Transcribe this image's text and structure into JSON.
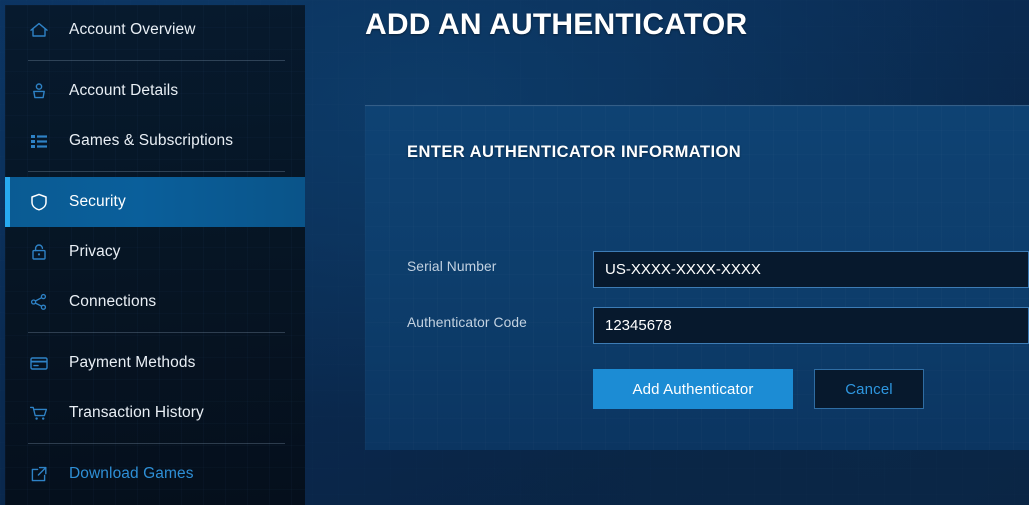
{
  "page": {
    "title": "ADD AN AUTHENTICATOR"
  },
  "sidebar": {
    "items": [
      {
        "id": "account-overview",
        "label": "Account Overview",
        "icon": "home-icon",
        "state": "default"
      },
      {
        "id": "account-details",
        "label": "Account Details",
        "icon": "person-icon",
        "state": "default"
      },
      {
        "id": "games-subscriptions",
        "label": "Games & Subscriptions",
        "icon": "list-icon",
        "state": "default"
      },
      {
        "id": "security",
        "label": "Security",
        "icon": "shield-icon",
        "state": "active"
      },
      {
        "id": "privacy",
        "label": "Privacy",
        "icon": "lock-icon",
        "state": "default"
      },
      {
        "id": "connections",
        "label": "Connections",
        "icon": "share-nodes-icon",
        "state": "default"
      },
      {
        "id": "payment-methods",
        "label": "Payment Methods",
        "icon": "credit-card-icon",
        "state": "default"
      },
      {
        "id": "transaction-history",
        "label": "Transaction History",
        "icon": "shopping-cart-icon",
        "state": "default"
      },
      {
        "id": "download-games",
        "label": "Download Games",
        "icon": "external-link-icon",
        "state": "link"
      }
    ]
  },
  "panel": {
    "heading": "ENTER AUTHENTICATOR INFORMATION",
    "fields": {
      "serial_number": {
        "label": "Serial Number",
        "value": "US-XXXX-XXXX-XXXX",
        "placeholder": "US-XXXX-XXXX-XXXX"
      },
      "authenticator_code": {
        "label": "Authenticator Code",
        "value": "12345678",
        "placeholder": "12345678"
      }
    },
    "buttons": {
      "submit": "Add Authenticator",
      "cancel": "Cancel"
    }
  },
  "colors": {
    "accent_blue": "#1c8cd4",
    "active_bar": "#27a9f0",
    "link_blue": "#2e8fd6",
    "panel_bg": "#0e4273",
    "sidebar_bg": "#071a2e",
    "input_bg": "#07192d",
    "input_border": "#3d7cb5",
    "label_text": "#c3d2e1"
  }
}
